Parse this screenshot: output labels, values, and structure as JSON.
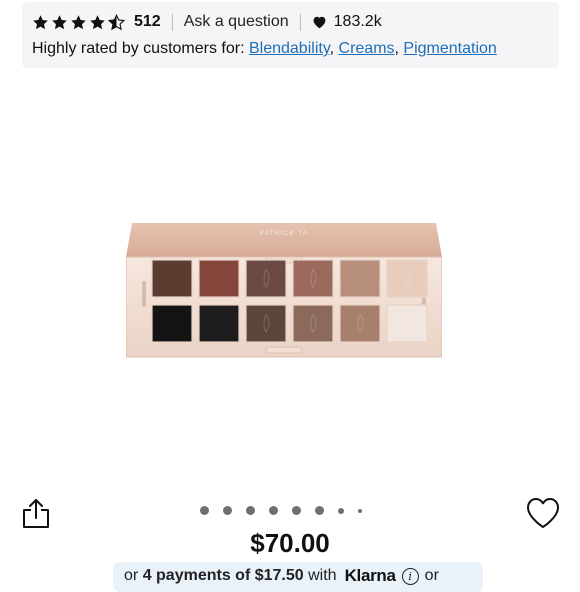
{
  "rating": {
    "stars": 4.5,
    "count": "512",
    "ask_label": "Ask a question",
    "loves": "183.2k"
  },
  "highlights": {
    "prefix": "Highly rated by customers for:",
    "tags": [
      "Blendability",
      "Creams",
      "Pigmentation"
    ]
  },
  "product": {
    "image_icon": "eyeshadow-palette",
    "brand_on_lid": "PATRICK TA"
  },
  "carousel": {
    "total_dots": 8,
    "active_index": 0
  },
  "price": "$70.00",
  "klarna": {
    "prefix": "or",
    "installments": "4 payments of $17.50",
    "with": "with",
    "brand": "Klarna",
    "suffix": "or"
  },
  "colors": {
    "link": "#1f6fb8",
    "card_bg": "#f5f5f7",
    "klarna_bg": "#e9f1f9"
  }
}
